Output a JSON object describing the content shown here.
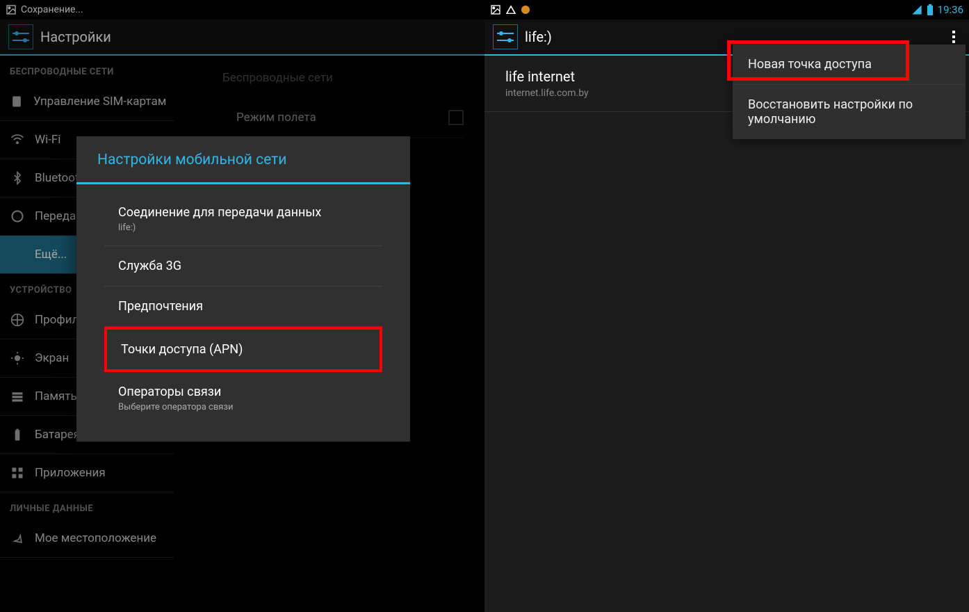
{
  "left": {
    "status": {
      "saving": "Сохранение..."
    },
    "header": {
      "title": "Настройки"
    },
    "sidebar": {
      "section_wireless": "БЕСПРОВОДНЫЕ СЕТИ",
      "items_wireless": [
        {
          "label": "Управление SIM-картам"
        },
        {
          "label": "Wi-Fi"
        },
        {
          "label": "Bluetooth"
        },
        {
          "label": "Передача"
        },
        {
          "label": "Ещё...",
          "active": true
        }
      ],
      "section_device": "УСТРОЙСТВО",
      "items_device": [
        {
          "label": "Профили"
        },
        {
          "label": "Экран"
        },
        {
          "label": "Память"
        },
        {
          "label": "Батарея"
        },
        {
          "label": "Приложения"
        }
      ],
      "section_personal": "ЛИЧНЫЕ ДАННЫЕ",
      "items_personal": [
        {
          "label": "Мое местоположение"
        }
      ]
    },
    "content": {
      "header": "Беспроводные сети",
      "items": [
        {
          "label": "Режим полета"
        }
      ]
    },
    "dialog": {
      "title": "Настройки мобильной сети",
      "items": [
        {
          "primary": "Соединение для передачи данных",
          "secondary": "life:)"
        },
        {
          "primary": "Служба 3G"
        },
        {
          "primary": "Предпочтения"
        },
        {
          "primary": "Точки доступа (APN)",
          "highlight": true
        },
        {
          "primary": "Операторы связи",
          "secondary": "Выберите оператора связи"
        }
      ]
    }
  },
  "right": {
    "status": {
      "time": "19:36"
    },
    "header": {
      "title": "life:)"
    },
    "apn": {
      "name": "life internet",
      "apn": "internet.life.com.by"
    },
    "popup": {
      "items": [
        {
          "label": "Новая точка доступа",
          "highlight": true
        },
        {
          "label": "Восстановить настройки по умолчанию"
        }
      ]
    }
  }
}
